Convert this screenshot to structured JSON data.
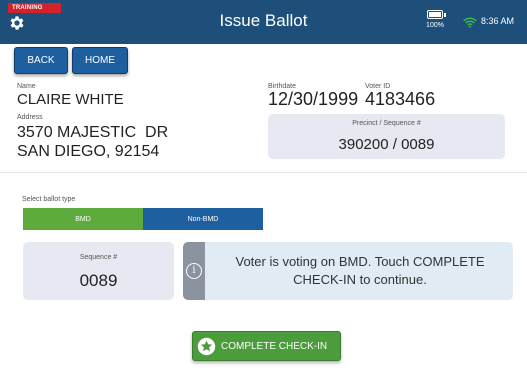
{
  "header": {
    "training_label": "TRAINING",
    "title": "Issue Ballot",
    "battery_level": "100%",
    "time": "8:36 AM",
    "bg_color": "#1e4f7a"
  },
  "nav": {
    "back_label": "BACK",
    "home_label": "HOME"
  },
  "voter": {
    "name_label": "Name",
    "name": "CLAIRE WHITE",
    "address_label": "Address",
    "address_line1": "3570 MAJESTIC  DR",
    "address_line2": "SAN DIEGO, 92154",
    "birthdate_label": "Birthdate",
    "birthdate": "12/30/1999",
    "voter_id_label": "Voter ID",
    "voter_id": "4183466",
    "precinct_label": "Precinct / Sequence #",
    "precinct_value": "390200 / 0089"
  },
  "ballot": {
    "select_label": "Select ballot type",
    "options": [
      "BMD",
      "Non-BMD"
    ],
    "selected": "BMD",
    "sequence_label": "Sequence #",
    "sequence_value": "0089",
    "info_message": "Voter is voting on BMD. Touch COMPLETE CHECK-IN to continue."
  },
  "actions": {
    "complete_label": "COMPLETE CHECK-IN"
  },
  "icons": {
    "settings": "gear-icon",
    "battery": "battery-icon",
    "wifi": "wifi-icon",
    "info": "info-icon",
    "complete": "star-icon"
  },
  "colors": {
    "accent_blue": "#1e5fa0",
    "success_green": "#5cab3c",
    "training_red": "#d2232a"
  }
}
